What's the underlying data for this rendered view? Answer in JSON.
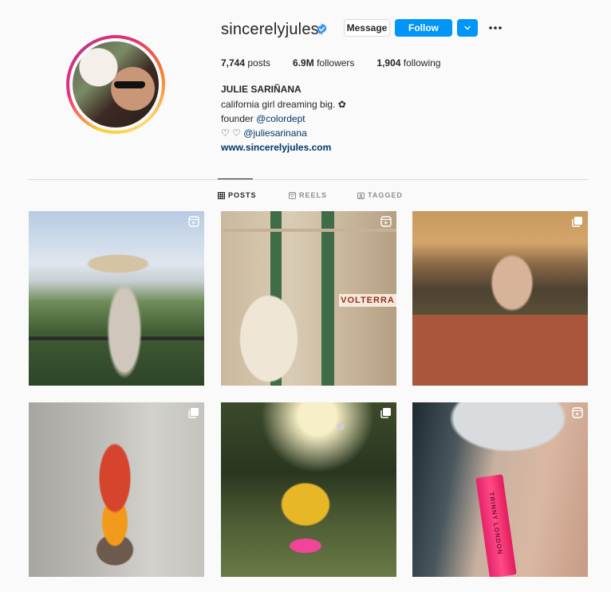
{
  "profile": {
    "username": "sincerelyjules",
    "verified": true,
    "full_name": "JULIE SARIÑANA",
    "bio_line1": "california girl dreaming big. ✿",
    "bio_founder_prefix": "founder ",
    "bio_founder_link": "@colordept",
    "bio_line3_prefix": "♡ ♡ ",
    "bio_line3_link": "@juliesarinana",
    "website": "www.sincerelyjules.com"
  },
  "actions": {
    "message_label": "Message",
    "follow_label": "Follow"
  },
  "stats": {
    "posts_value": "7,744",
    "posts_label": " posts",
    "followers_value": "6.9M",
    "followers_label": " followers",
    "following_value": "1,904",
    "following_label": " following"
  },
  "tabs": [
    {
      "label": "POSTS",
      "icon": "grid-icon",
      "active": true
    },
    {
      "label": "REELS",
      "icon": "reels-icon",
      "active": false
    },
    {
      "label": "TAGGED",
      "icon": "tagged-icon",
      "active": false
    }
  ],
  "posts": [
    {
      "badge": "reel-icon",
      "desc": ""
    },
    {
      "badge": "reel-icon",
      "desc": ""
    },
    {
      "badge": "carousel-icon",
      "desc": ""
    },
    {
      "badge": "carousel-icon",
      "desc": ""
    },
    {
      "badge": "carousel-icon",
      "desc": ""
    },
    {
      "badge": "reel-icon",
      "desc": ""
    }
  ],
  "post_overlay_texts": {
    "storefront_sign": "VOLTERRA",
    "product_text": "TRINNY LONDON"
  },
  "colors": {
    "follow_blue": "#0095f6",
    "link_blue": "#00376b",
    "verified_blue": "#3897f0"
  }
}
